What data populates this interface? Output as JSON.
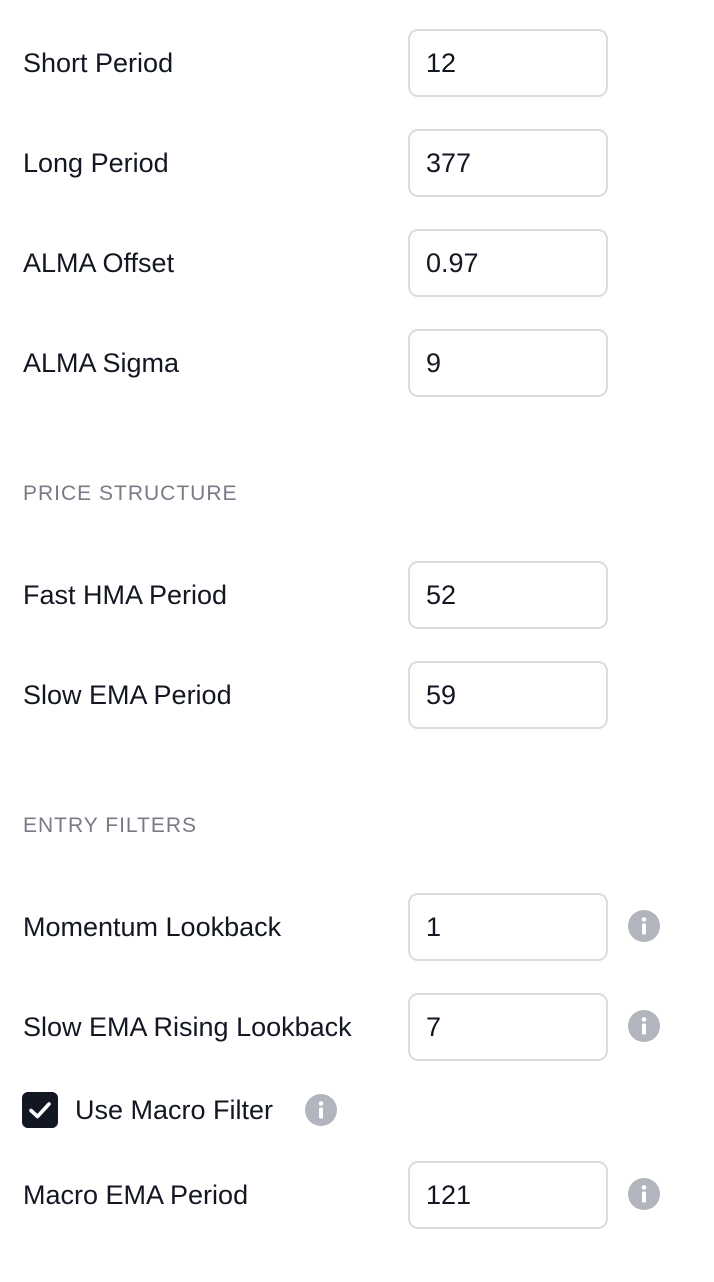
{
  "fields": [
    {
      "label": "Short Period",
      "value": "12"
    },
    {
      "label": "Long Period",
      "value": "377"
    },
    {
      "label": "ALMA Offset",
      "value": "0.97"
    },
    {
      "label": "ALMA Sigma",
      "value": "9"
    }
  ],
  "price_structure": {
    "title": "PRICE STRUCTURE",
    "fields": [
      {
        "label": "Fast HMA Period",
        "value": "52"
      },
      {
        "label": "Slow EMA Period",
        "value": "59"
      }
    ]
  },
  "entry_filters": {
    "title": "ENTRY FILTERS",
    "momentum_lookback": {
      "label": "Momentum Lookback",
      "value": "1"
    },
    "slow_ema_rising_lookback": {
      "label": "Slow EMA Rising Lookback",
      "value": "7"
    },
    "use_macro_filter": {
      "label": "Use Macro Filter",
      "checked": true
    },
    "macro_ema_period": {
      "label": "Macro EMA Period",
      "value": "121"
    }
  },
  "icons": {
    "info": "info-icon",
    "check": "checkmark-icon"
  },
  "colors": {
    "text": "#131722",
    "section_title": "#787b86",
    "input_border": "#dadce0",
    "info_icon": "#b2b5be",
    "checkbox_fill": "#131722"
  }
}
